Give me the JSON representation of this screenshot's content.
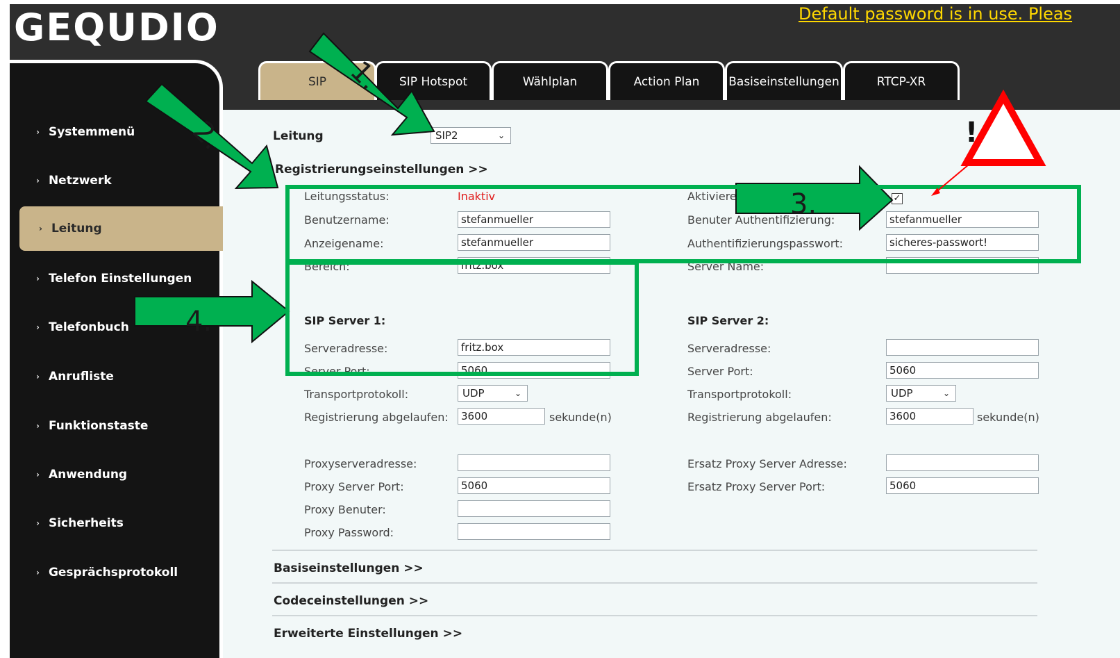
{
  "brand": "GEQUDIO",
  "banner": "Default password is in use. Pleas",
  "sidebar": {
    "items": [
      {
        "label": "Systemmenü"
      },
      {
        "label": "Netzwerk"
      },
      {
        "label": "Leitung",
        "active": true
      },
      {
        "label": "Telefon Einstellungen"
      },
      {
        "label": "Telefonbuch"
      },
      {
        "label": "Anrufliste"
      },
      {
        "label": "Funktionstaste"
      },
      {
        "label": "Anwendung"
      },
      {
        "label": "Sicherheits"
      },
      {
        "label": "Gesprächsprotokoll"
      }
    ]
  },
  "tabs": [
    "SIP",
    "SIP Hotspot",
    "Wählplan",
    "Action Plan",
    "Basiseinstellungen",
    "RTCP-XR"
  ],
  "line": {
    "label": "Leitung",
    "value": "SIP2"
  },
  "registration": {
    "header": "Registrierungseinstellungen >>",
    "status_label": "Leitungsstatus:",
    "status_value": "Inaktiv",
    "username_label": "Benutzername:",
    "username_value": "stefanmueller",
    "display_label": "Anzeigename:",
    "display_value": "stefanmueller",
    "realm_label": "Bereich:",
    "realm_value": "fritz.box",
    "activate_label": "Aktiviere",
    "auth_user_label": "Benuter Authentifizierung:",
    "auth_user_value": "stefanmueller",
    "auth_pass_label": "Authentifizierungspasswort:",
    "auth_pass_value": "sicheres-passwort!",
    "server_name_label": "Server Name:",
    "server_name_value": ""
  },
  "server1": {
    "title": "SIP Server 1:",
    "addr_label": "Serveradresse:",
    "addr_value": "fritz.box",
    "port_label": "Server Port:",
    "port_value": "5060",
    "transport_label": "Transportprotokoll:",
    "transport_value": "UDP",
    "expire_label": "Registrierung abgelaufen:",
    "expire_value": "3600",
    "unit": "sekunde(n)"
  },
  "server2": {
    "title": "SIP Server 2:",
    "addr_label": "Serveradresse:",
    "addr_value": "",
    "port_label": "Server Port:",
    "port_value": "5060",
    "transport_label": "Transportprotokoll:",
    "transport_value": "UDP",
    "expire_label": "Registrierung abgelaufen:",
    "expire_value": "3600",
    "unit": "sekunde(n)"
  },
  "proxy": {
    "addr_label": "Proxyserveradresse:",
    "addr_value": "",
    "port_label": "Proxy Server Port:",
    "port_value": "5060",
    "user_label": "Proxy Benuter:",
    "user_value": "",
    "pass_label": "Proxy Password:",
    "pass_value": "",
    "backup_addr_label": "Ersatz Proxy Server Adresse:",
    "backup_addr_value": "",
    "backup_port_label": "Ersatz Proxy Server Port:",
    "backup_port_value": "5060"
  },
  "sections": [
    "Basiseinstellungen >>",
    "Codeceinstellungen >>",
    "Erweiterte Einstellungen >>"
  ],
  "annotations": {
    "step1": "1.",
    "step2": "2.",
    "step3": "3.",
    "step4": "4.",
    "warning": "!"
  },
  "colors": {
    "accent": "#c9b48a",
    "highlight": "#00b050",
    "warning": "#ff0000",
    "banner": "#ffd800"
  }
}
